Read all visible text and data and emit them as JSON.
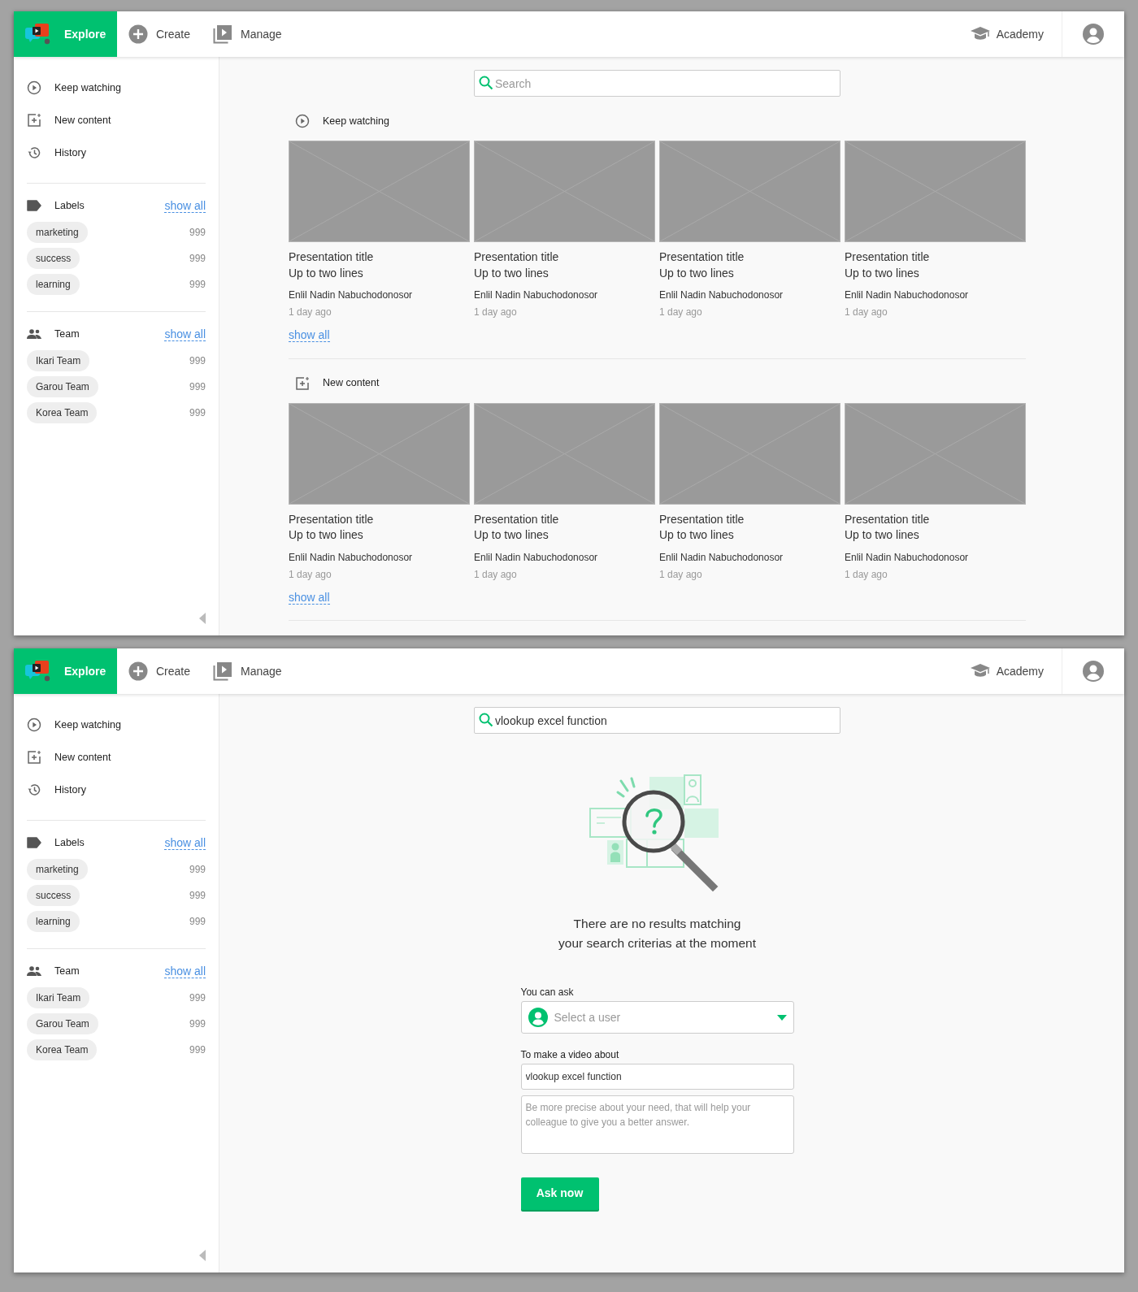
{
  "screens": [
    {
      "kind": "browse",
      "nav": {
        "items": [
          {
            "kind": "explore",
            "label": "Explore",
            "selected": true
          },
          {
            "kind": "create",
            "label": "Create",
            "selected": false
          },
          {
            "kind": "manage",
            "label": "Manage",
            "selected": false
          }
        ],
        "academy": "Academy"
      },
      "sidebar": {
        "items": [
          {
            "kind": "play",
            "label": "Keep watching"
          },
          {
            "kind": "new",
            "label": "New content"
          },
          {
            "kind": "history",
            "label": "History"
          }
        ],
        "groups": [
          {
            "kind": "labels",
            "title": "Labels",
            "show_all": "show all",
            "entries": [
              {
                "label": "marketing",
                "count": "999"
              },
              {
                "label": "success",
                "count": "999"
              },
              {
                "label": "learning",
                "count": "999"
              }
            ]
          },
          {
            "kind": "team",
            "title": "Team",
            "show_all": "show all",
            "entries": [
              {
                "label": "Ikari Team",
                "count": "999"
              },
              {
                "label": "Garou Team",
                "count": "999"
              },
              {
                "label": "Korea Team",
                "count": "999"
              }
            ]
          }
        ]
      },
      "search": {
        "placeholder": "Search"
      },
      "sections": [
        {
          "kind": "play",
          "title": "Keep watching",
          "show_all": "show all",
          "cards": [
            {
              "title": "Presentation title\nUp to two lines",
              "author": "Enlil Nadin Nabuchodonosor",
              "date": "1 day ago"
            },
            {
              "title": "Presentation title\nUp to two lines",
              "author": "Enlil Nadin Nabuchodonosor",
              "date": "1 day ago"
            },
            {
              "title": "Presentation title\nUp to two lines",
              "author": "Enlil Nadin Nabuchodonosor",
              "date": "1 day ago"
            },
            {
              "title": "Presentation title\nUp to two lines",
              "author": "Enlil Nadin Nabuchodonosor",
              "date": "1 day ago"
            }
          ]
        },
        {
          "kind": "new",
          "title": "New content",
          "show_all": "show all",
          "cards": [
            {
              "title": "Presentation title\nUp to two lines",
              "author": "Enlil Nadin Nabuchodonosor",
              "date": "1 day ago"
            },
            {
              "title": "Presentation title\nUp to two lines",
              "author": "Enlil Nadin Nabuchodonosor",
              "date": "1 day ago"
            },
            {
              "title": "Presentation title\nUp to two lines",
              "author": "Enlil Nadin Nabuchodonosor",
              "date": "1 day ago"
            },
            {
              "title": "Presentation title\nUp to two lines",
              "author": "Enlil Nadin Nabuchodonosor",
              "date": "1 day ago"
            }
          ]
        }
      ]
    },
    {
      "kind": "ask",
      "nav": {
        "items": [
          {
            "kind": "explore",
            "label": "Explore",
            "selected": true
          },
          {
            "kind": "create",
            "label": "Create",
            "selected": false
          },
          {
            "kind": "manage",
            "label": "Manage",
            "selected": false
          }
        ],
        "academy": "Academy"
      },
      "sidebar": {
        "items": [
          {
            "kind": "play",
            "label": "Keep watching"
          },
          {
            "kind": "new",
            "label": "New content"
          },
          {
            "kind": "history",
            "label": "History"
          }
        ],
        "groups": [
          {
            "kind": "labels",
            "title": "Labels",
            "show_all": "show all",
            "entries": [
              {
                "label": "marketing",
                "count": "999"
              },
              {
                "label": "success",
                "count": "999"
              },
              {
                "label": "learning",
                "count": "999"
              }
            ]
          },
          {
            "kind": "team",
            "title": "Team",
            "show_all": "show all",
            "entries": [
              {
                "label": "Ikari Team",
                "count": "999"
              },
              {
                "label": "Garou Team",
                "count": "999"
              },
              {
                "label": "Korea Team",
                "count": "999"
              }
            ]
          }
        ]
      },
      "search": {
        "value": "vlookup excel function"
      },
      "empty_message": "There are no results matching\nyour search criterias at the moment",
      "form": {
        "ask_label": "You can ask",
        "user_select": {
          "placeholder": "Select a user"
        },
        "topic_label": "To make a video about",
        "topic": {
          "value": "vlookup excel function"
        },
        "details": {
          "placeholder": "Be more precise about your need, that will help your colleague to give you a better answer."
        },
        "button": "Ask now"
      }
    }
  ]
}
